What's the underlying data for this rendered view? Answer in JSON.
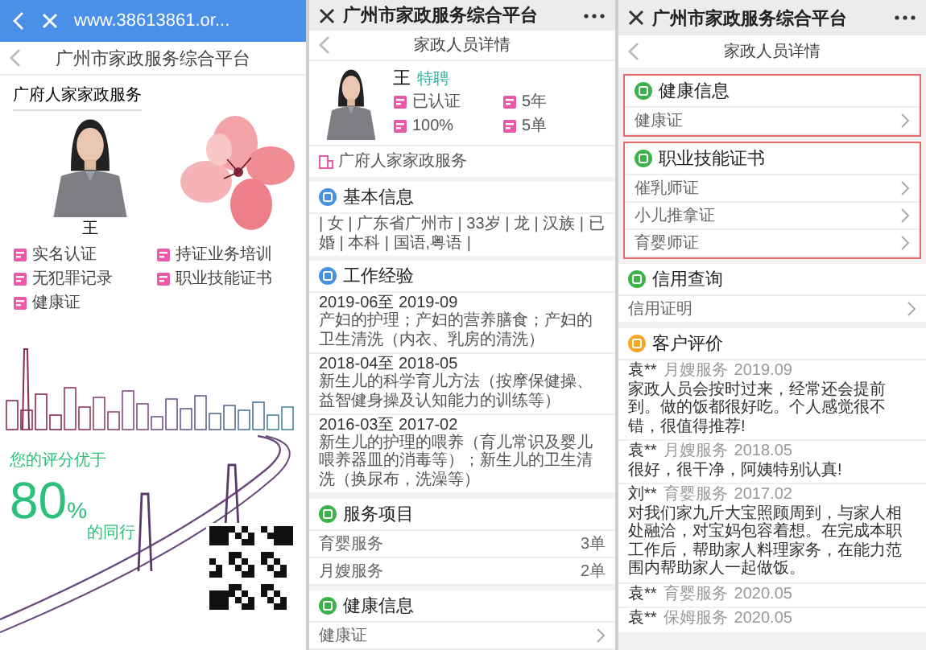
{
  "browser_screen": {
    "url": "www.38613861.or...",
    "title": "广州市家政服务综合平台",
    "company": "广府人家家政服务",
    "name": "王",
    "badges": [
      "实名认证",
      "持证业务培训",
      "无犯罪记录",
      "职业技能证书",
      "健康证"
    ],
    "score": {
      "prefix": "您的评分优于",
      "value": "80",
      "unit": "%",
      "suffix": "的同行"
    }
  },
  "profile_screen": {
    "title": "广州市家政服务综合平台",
    "subtitle": "家政人员详情",
    "name": "王",
    "name_tag": "特聘",
    "stats": [
      "已认证",
      "5年",
      "100%",
      "5单"
    ],
    "company": "广府人家家政服务",
    "sections": [
      {
        "kind": "tags",
        "title": "基本信息",
        "color": "#4a90e2",
        "text": "| 女 | 广东省广州市 | 33岁 | 龙 | 汉族 | 已婚 | 本科 | 国语,粤语 |"
      },
      {
        "kind": "experience",
        "title": "工作经验",
        "color": "#4a90e2",
        "entries": [
          {
            "period": "2019-06至 2019-09",
            "text": "产妇的护理；产妇的营养膳食；产妇的卫生清洗（内衣、乳房的清洗）"
          },
          {
            "period": "2018-04至 2018-05",
            "text": "新生儿的科学育儿方法（按摩保健操、益智健身操及认知能力的训练等）"
          },
          {
            "period": "2016-03至 2017-02",
            "text": "新生儿的护理的喂养（育儿常识及婴儿喂养器皿的消毒等）；新生儿的卫生清洗（换尿布，洗澡等）"
          }
        ]
      },
      {
        "kind": "rows",
        "title": "服务项目",
        "color": "#3cb34a",
        "rows": [
          {
            "label": "育婴服务",
            "value": "3单"
          },
          {
            "label": "月嫂服务",
            "value": "2单"
          }
        ]
      },
      {
        "kind": "links",
        "title": "健康信息",
        "color": "#3cb34a",
        "rows": [
          {
            "label": "健康证"
          }
        ]
      }
    ]
  },
  "certificates_screen": {
    "title": "广州市家政服务综合平台",
    "subtitle": "家政人员详情",
    "sections": [
      {
        "kind": "links",
        "title": "健康信息",
        "color": "#3cb34a",
        "highlighted": true,
        "rows": [
          {
            "label": "健康证"
          }
        ]
      },
      {
        "kind": "links",
        "title": "职业技能证书",
        "color": "#3cb34a",
        "highlighted": true,
        "rows": [
          {
            "label": "催乳师证"
          },
          {
            "label": "小儿推拿证"
          },
          {
            "label": "育婴师证"
          }
        ]
      },
      {
        "kind": "links",
        "title": "信用查询",
        "color": "#3cb34a",
        "highlighted": false,
        "rows": [
          {
            "label": "信用证明"
          }
        ]
      },
      {
        "kind": "reviews",
        "title": "客户评价",
        "color": "#f5a623",
        "highlighted": false,
        "reviews": [
          {
            "user": "袁**",
            "service": "月嫂服务",
            "date": "2019.09",
            "text": "家政人员会按时过来，经常还会提前到。做的饭都很好吃。个人感觉很不错，很值得推荐!"
          },
          {
            "user": "袁**",
            "service": "月嫂服务",
            "date": "2018.05",
            "text": "很好，很干净，阿姨特别认真!"
          },
          {
            "user": "刘**",
            "service": "育婴服务",
            "date": "2017.02",
            "text": "对我们家九斤大宝照顾周到，与家人相处融洽，对宝妈包容着想。在完成本职工作后，帮助家人料理家务，在能力范围内帮助家人一起做饭。"
          },
          {
            "user": "袁**",
            "service": "育婴服务",
            "date": "2020.05"
          },
          {
            "user": "袁**",
            "service": "保姆服务",
            "date": "2020.05"
          }
        ]
      }
    ]
  }
}
